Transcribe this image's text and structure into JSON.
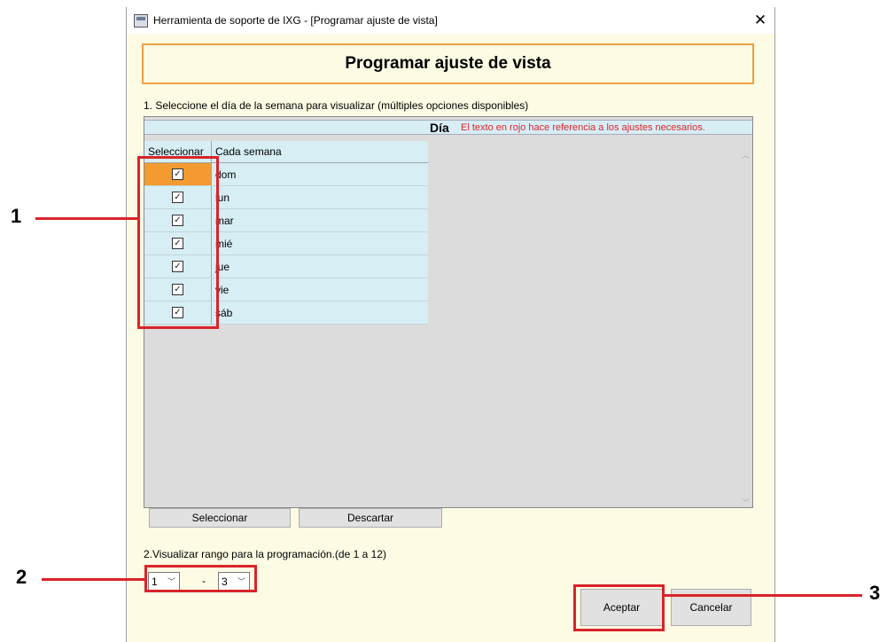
{
  "window": {
    "title": "Herramienta de soporte de IXG - [Programar ajuste de vista]",
    "close_glyph": "✕"
  },
  "header": {
    "title": "Programar ajuste de vista"
  },
  "step1": {
    "label": "1. Seleccione el día de la semana para visualizar (múltiples opciones disponibles)",
    "group_label": "Día",
    "note": "El texto en rojo hace referencia a los ajustes necesarios.",
    "note_color": "#e0242c",
    "columns": [
      "Seleccionar",
      "Cada semana"
    ],
    "rows": [
      {
        "day": "dom",
        "checked": true,
        "selected": true
      },
      {
        "day": "lun",
        "checked": true,
        "selected": false
      },
      {
        "day": "mar",
        "checked": true,
        "selected": false
      },
      {
        "day": "mié",
        "checked": true,
        "selected": false
      },
      {
        "day": "jue",
        "checked": true,
        "selected": false
      },
      {
        "day": "vie",
        "checked": true,
        "selected": false
      },
      {
        "day": "sáb",
        "checked": true,
        "selected": false
      }
    ]
  },
  "buttons": {
    "select": "Seleccionar",
    "discard": "Descartar",
    "accept": "Aceptar",
    "cancel": "Cancelar"
  },
  "step2": {
    "label": "2.Visualizar rango para la programación.(de 1 a 12)",
    "from_value": "1",
    "separator": "-",
    "to_value": "3"
  },
  "callouts": {
    "one": "1",
    "two": "2",
    "three": "3",
    "color": "#d9242a"
  },
  "icons": {
    "checkbox": "checkbox-checked-icon",
    "chevron": "chevron-down-icon",
    "close": "close-icon"
  }
}
